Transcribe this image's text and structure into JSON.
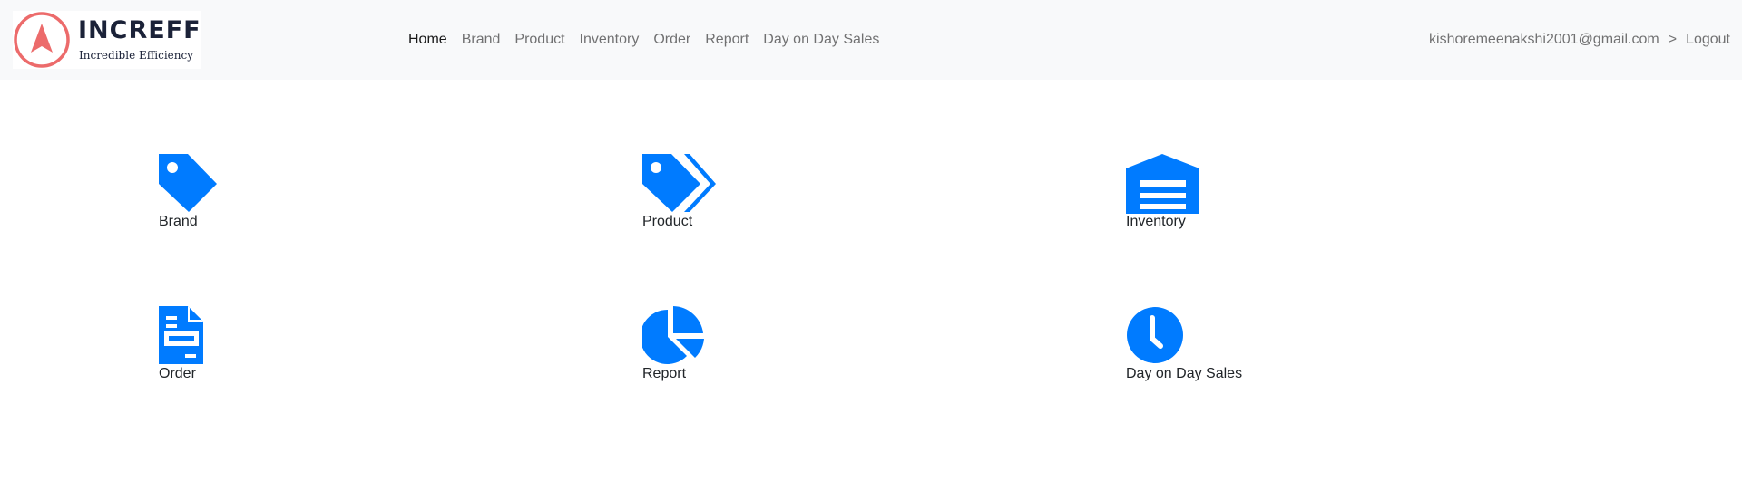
{
  "header": {
    "logo": {
      "text": "INCREFF",
      "tagline": "Incredible Efficiency",
      "icon": "compass-arrow-logo",
      "colors": {
        "ring": "#ec6b6b",
        "text": "#1b2238"
      }
    },
    "nav": [
      {
        "label": "Home",
        "active": true
      },
      {
        "label": "Brand",
        "active": false
      },
      {
        "label": "Product",
        "active": false
      },
      {
        "label": "Inventory",
        "active": false
      },
      {
        "label": "Order",
        "active": false
      },
      {
        "label": "Report",
        "active": false
      },
      {
        "label": "Day on Day Sales",
        "active": false
      }
    ],
    "user": {
      "email": "kishoremeenakshi2001@gmail.com",
      "separator": ">",
      "logout": "Logout"
    }
  },
  "tiles": [
    {
      "label": "Brand",
      "icon": "tag-icon"
    },
    {
      "label": "Product",
      "icon": "tags-icon"
    },
    {
      "label": "Inventory",
      "icon": "warehouse-icon"
    },
    {
      "label": "Order",
      "icon": "invoice-icon"
    },
    {
      "label": "Report",
      "icon": "pie-chart-icon"
    },
    {
      "label": "Day on Day Sales",
      "icon": "clock-icon"
    }
  ],
  "theme": {
    "accent": "#007bff",
    "navbar_bg": "#f8f9fa"
  }
}
